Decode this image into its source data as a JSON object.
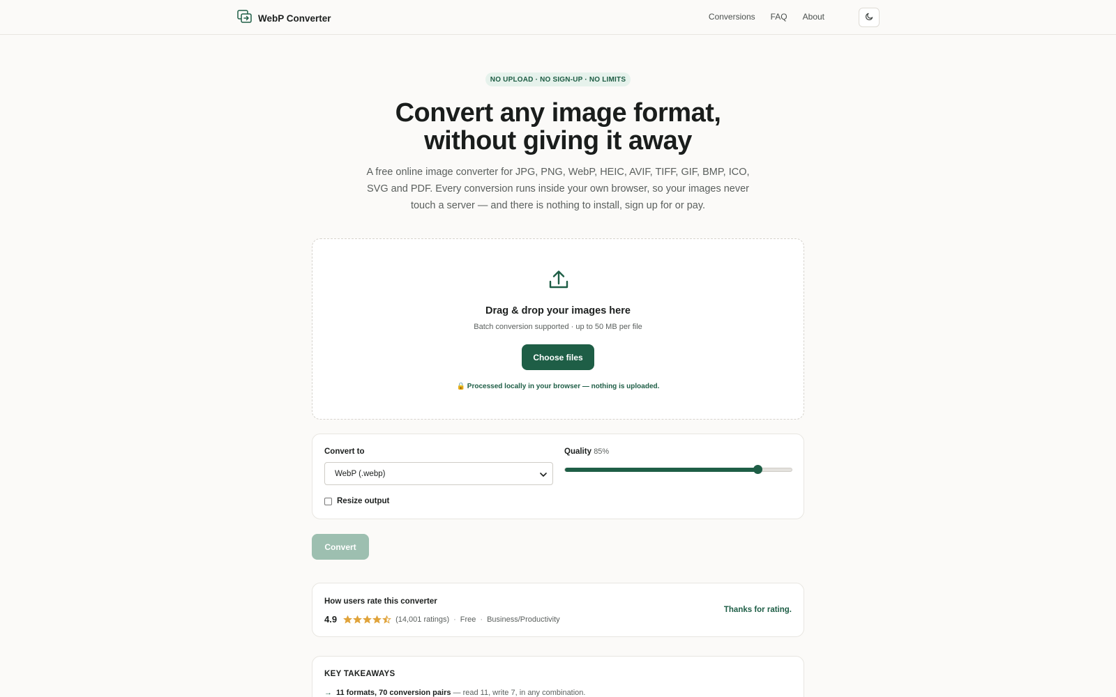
{
  "header": {
    "brand": "WebP Converter",
    "nav": [
      "Conversions",
      "FAQ",
      "About"
    ]
  },
  "hero": {
    "badge": "NO UPLOAD · NO SIGN-UP · NO LIMITS",
    "title_line1": "Convert any image format,",
    "title_line2": "without giving it away",
    "subtitle": "A free online image converter for JPG, PNG, WebP, HEIC, AVIF, TIFF, GIF, BMP, ICO, SVG and PDF. Every conversion runs inside your own browser, so your images never touch a server — and there is nothing to install, sign up for or pay."
  },
  "dropzone": {
    "title": "Drag & drop your images here",
    "subtitle": "Batch conversion supported · up to 50 MB per file",
    "button": "Choose files",
    "note": "Processed locally in your browser — nothing is uploaded."
  },
  "options": {
    "convert_to_label": "Convert to",
    "format_selected": "WebP (.webp)",
    "quality_label": "Quality",
    "quality_value": "85%",
    "quality_fraction": 0.85,
    "resize_label": "Resize output",
    "resize_checked": false
  },
  "convert_button": "Convert",
  "rating": {
    "title": "How users rate this converter",
    "score": "4.9",
    "star_value": 4.5,
    "count": "(14,001 ratings)",
    "price": "Free",
    "category": "Business/Productivity",
    "separator": "·",
    "thanks": "Thanks for rating."
  },
  "takeaways": {
    "title": "KEY TAKEAWAYS",
    "item1_strong": "11 formats, 70 conversion pairs",
    "item1_rest": " — read 11, write 7, in any combination."
  },
  "colors": {
    "accent": "#1e5e46",
    "star": "#e0a33a",
    "badge_bg": "#e6f2ec"
  }
}
